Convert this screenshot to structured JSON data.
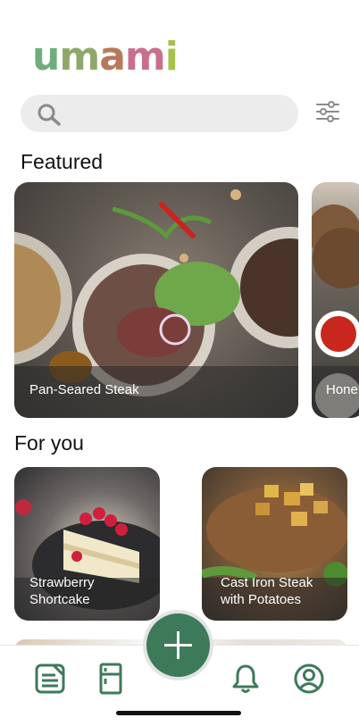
{
  "app": {
    "logo_text": "umami",
    "logo_colors": [
      "#6fae7a",
      "#8fa86a",
      "#b7795c",
      "#c86f8e",
      "#a7c24c"
    ]
  },
  "search": {
    "placeholder": "",
    "value": "",
    "icon": "search-icon"
  },
  "filter": {
    "icon": "sliders-icon"
  },
  "featured": {
    "title": "Featured",
    "cards": [
      {
        "label": "Pan-Seared Steak"
      },
      {
        "label": "Hone"
      }
    ]
  },
  "for_you": {
    "title": "For you",
    "cards": [
      {
        "label_line1": "Strawberry",
        "label_line2": "Shortcake"
      },
      {
        "label_line1": "Cast Iron Steak",
        "label_line2": "with Potatoes"
      }
    ]
  },
  "fab": {
    "icon": "plus-icon"
  },
  "bottom_nav": {
    "accent": "#3d7a5a",
    "items": [
      {
        "icon": "recipe-list-icon"
      },
      {
        "icon": "fridge-icon"
      },
      {
        "icon": "bell-icon"
      },
      {
        "icon": "profile-icon"
      }
    ]
  }
}
